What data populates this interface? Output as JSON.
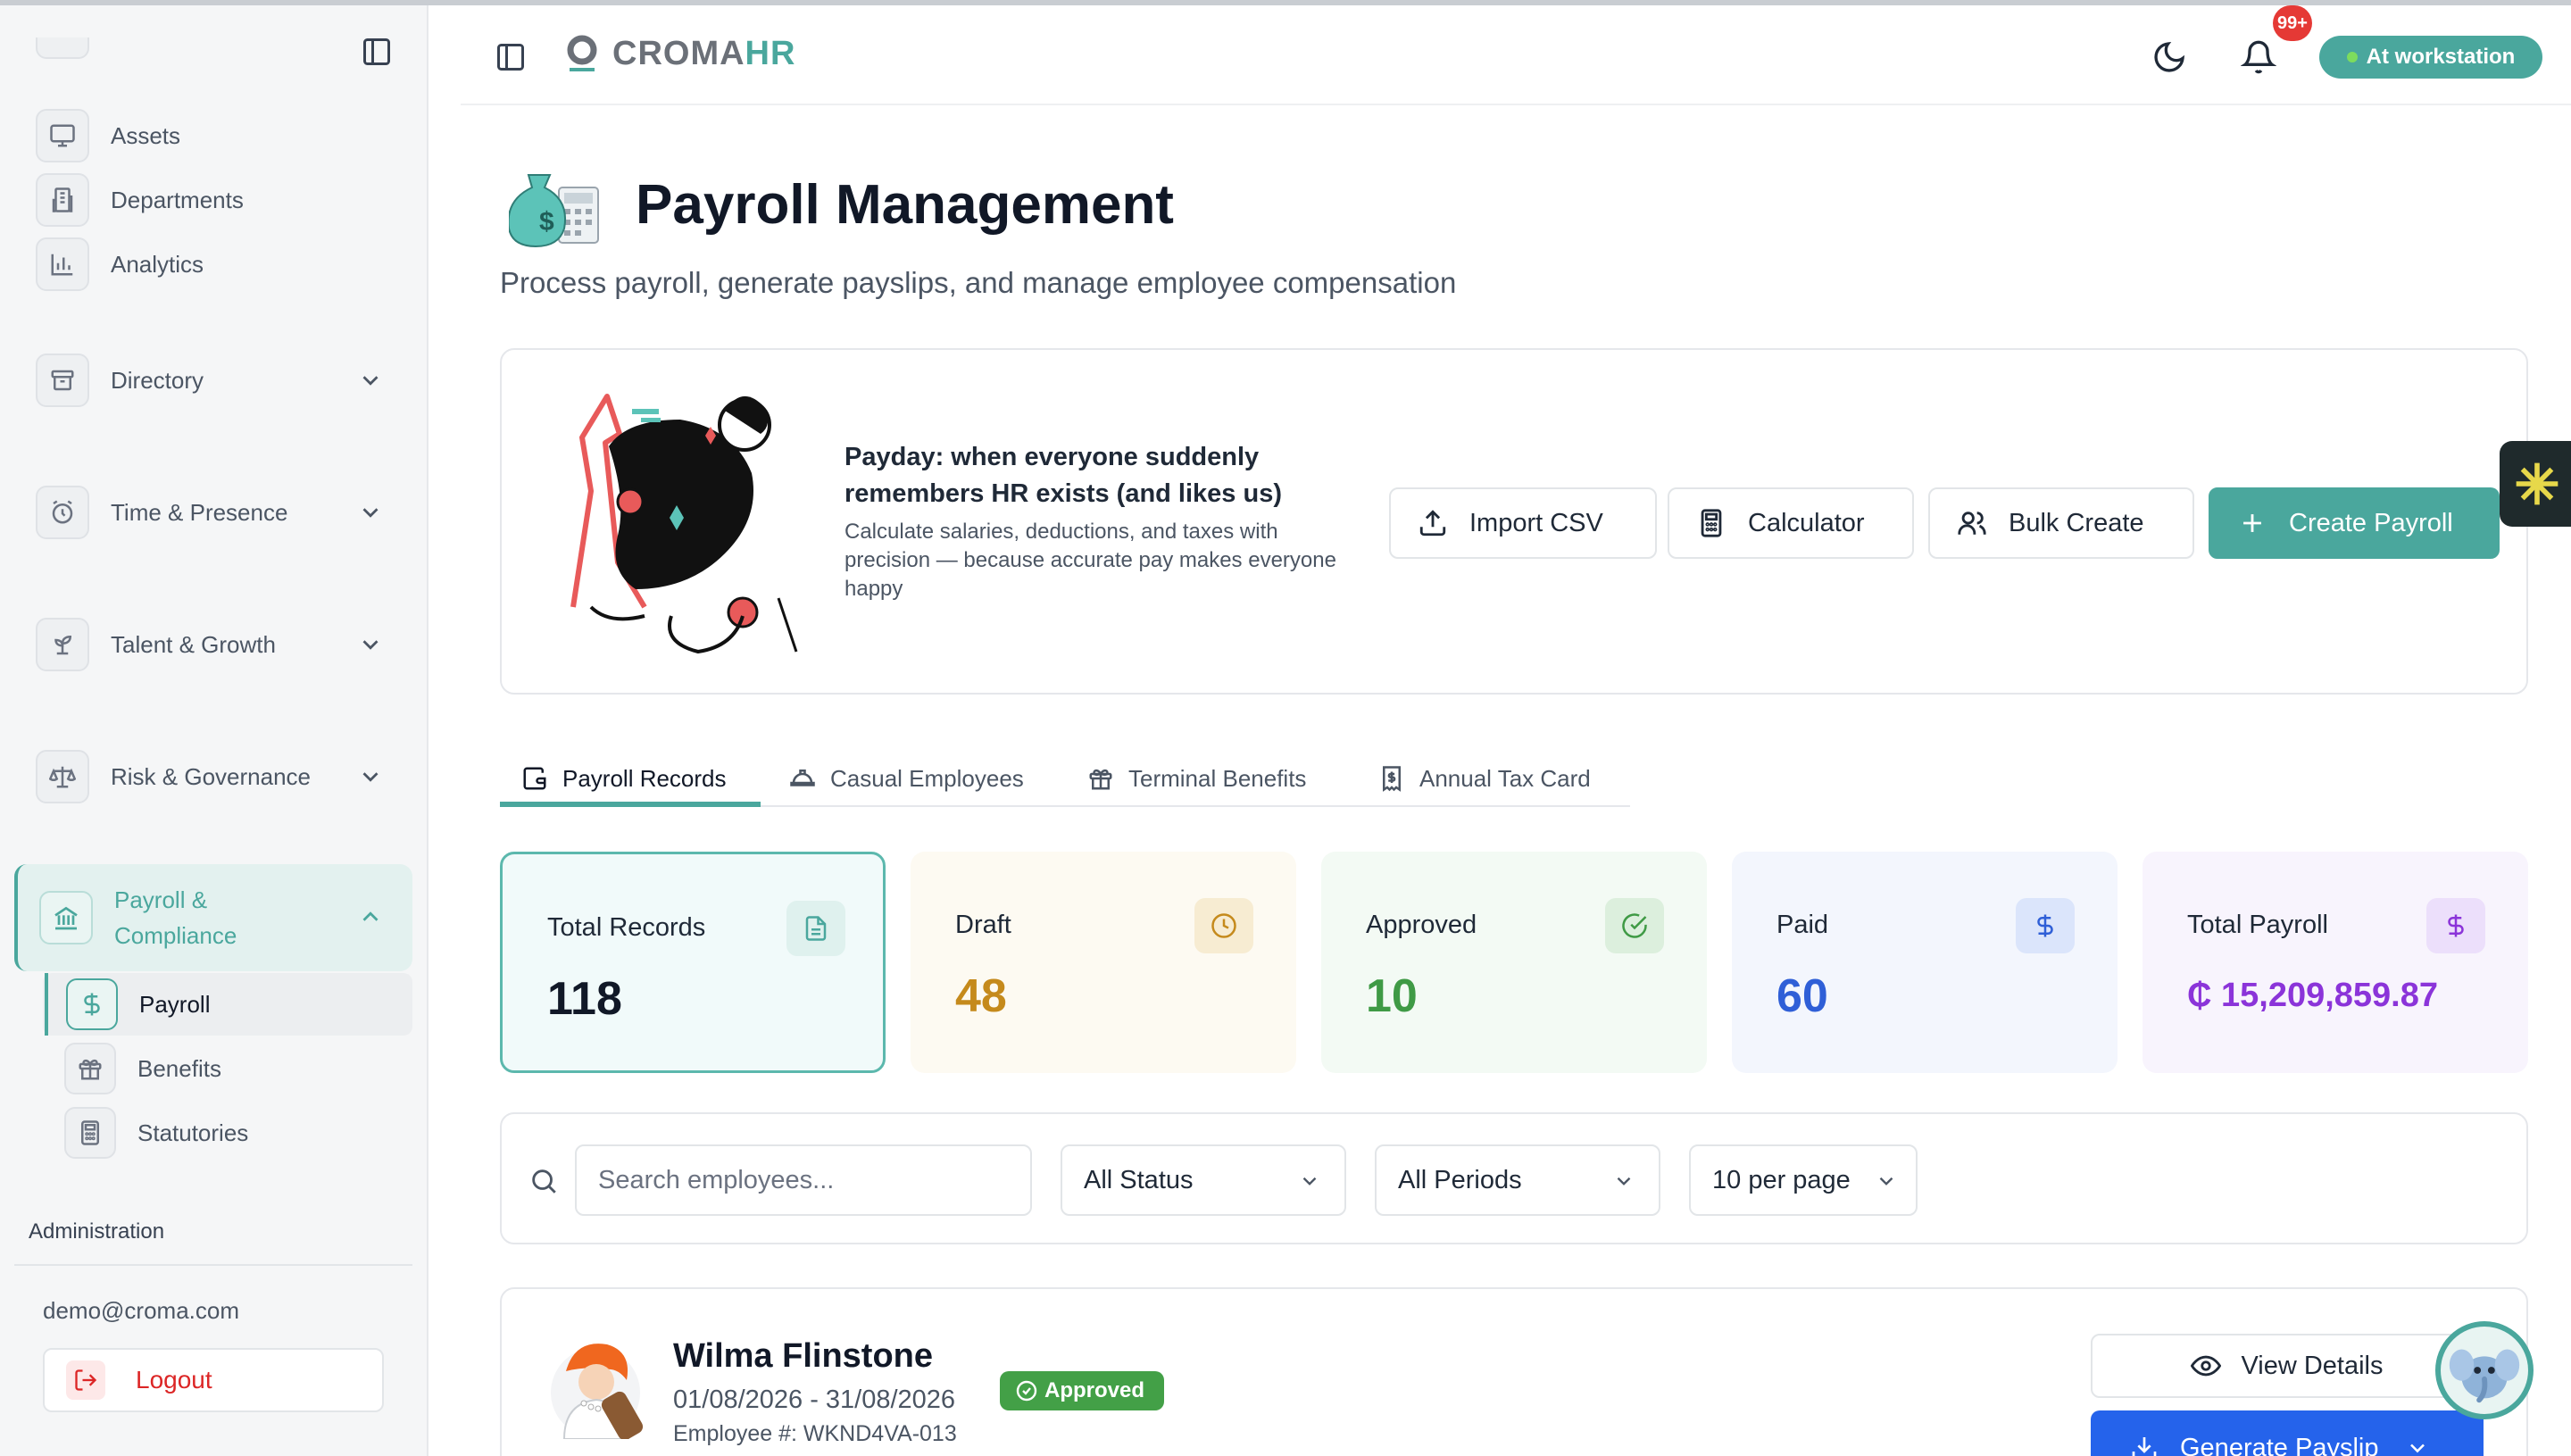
{
  "sidebar": {
    "items": [
      {
        "label": "Assets",
        "icon": "monitor-icon"
      },
      {
        "label": "Departments",
        "icon": "building-icon"
      },
      {
        "label": "Analytics",
        "icon": "bar-chart-icon"
      },
      {
        "label": "Directory",
        "icon": "archive-icon"
      },
      {
        "label": "Time & Presence",
        "icon": "alarm-clock-icon"
      },
      {
        "label": "Talent & Growth",
        "icon": "sprout-icon"
      },
      {
        "label": "Risk & Governance",
        "icon": "scale-icon"
      }
    ],
    "active_group": {
      "label": "Payroll & Compliance",
      "line1": "Payroll &",
      "line2": "Compliance",
      "icon": "landmark-icon"
    },
    "sub_items": [
      {
        "label": "Payroll",
        "icon": "dollar-icon"
      },
      {
        "label": "Benefits",
        "icon": "gift-icon"
      },
      {
        "label": "Statutories",
        "icon": "calculator-icon"
      }
    ],
    "admin_label": "Administration",
    "email": "demo@croma.com",
    "logout_label": "Logout"
  },
  "header": {
    "logo_part1": "CROMA",
    "logo_part2": "HR",
    "notification_count": "99+",
    "status_label": "At workstation"
  },
  "page": {
    "title": "Payroll Management",
    "subtitle": "Process payroll, generate payslips, and manage employee compensation"
  },
  "hero": {
    "headline": "Payday: when everyone suddenly remembers HR exists (and likes us)",
    "description": "Calculate salaries, deductions, and taxes with precision — because accurate pay makes everyone happy",
    "buttons": {
      "import": "Import CSV",
      "calculator": "Calculator",
      "bulk": "Bulk Create",
      "create": "Create Payroll"
    }
  },
  "tabs": [
    {
      "label": "Payroll Records",
      "icon": "wallet-icon"
    },
    {
      "label": "Casual Employees",
      "icon": "hard-hat-icon"
    },
    {
      "label": "Terminal Benefits",
      "icon": "gift-icon"
    },
    {
      "label": "Annual Tax Card",
      "icon": "receipt-icon"
    }
  ],
  "stats": [
    {
      "label": "Total Records",
      "value": "118",
      "color": "#111827",
      "bg": "#f1fafa",
      "icon_bg": "#dff1ee",
      "icon": "file-text-icon"
    },
    {
      "label": "Draft",
      "value": "48",
      "color": "#c58a1c",
      "bg": "#fdfaf2",
      "icon_bg": "#f7ecd2",
      "icon": "clock-icon"
    },
    {
      "label": "Approved",
      "value": "10",
      "color": "#3f9a45",
      "bg": "#f3faf4",
      "icon_bg": "#dcefdd",
      "icon": "check-circle-icon"
    },
    {
      "label": "Paid",
      "value": "60",
      "color": "#2f5fd7",
      "bg": "#f3f6fd",
      "icon_bg": "#dbe5fb",
      "icon": "dollar-icon"
    },
    {
      "label": "Total Payroll",
      "value": "₵ 15,209,859.87",
      "color": "#8b34d9",
      "bg": "#f8f4fd",
      "icon_bg": "#ecdffb",
      "icon": "dollar-icon"
    }
  ],
  "filters": {
    "search_placeholder": "Search employees...",
    "status": "All Status",
    "period": "All Periods",
    "per_page": "10 per page"
  },
  "record": {
    "name": "Wilma Flinstone",
    "period": "01/08/2026 - 31/08/2026",
    "employee_no": "Employee #: WKND4VA-013",
    "status": "Approved",
    "view_label": "View Details",
    "generate_label": "Generate Payslip"
  },
  "colors": {
    "accent": "#4aa79d",
    "primary_blue": "#2563eb",
    "danger": "#dc2626"
  }
}
